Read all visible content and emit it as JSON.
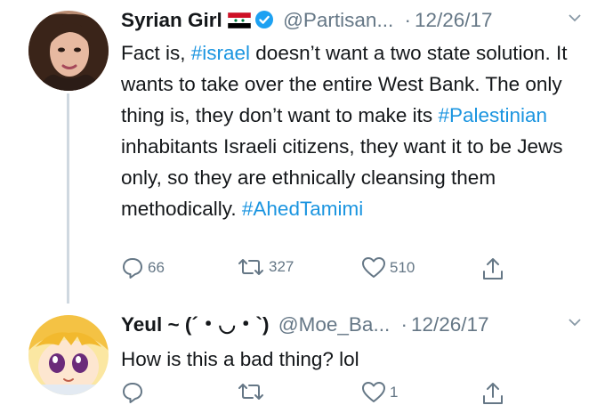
{
  "tweets": [
    {
      "name": "Syrian Girl",
      "handle": "@Partisan...",
      "separator": "·",
      "date": "12/26/17",
      "text_segments": [
        {
          "t": "Fact is, "
        },
        {
          "t": "#israel",
          "tag": true
        },
        {
          "t": " doesn’t want a two state solution. It wants to take over the entire West Bank. The only thing is, they don’t want to make its "
        },
        {
          "t": "#Palestinian",
          "tag": true
        },
        {
          "t": " inhabitants Israeli citizens, they want it to be Jews only, so they are ethnically cleansing them methodically. "
        },
        {
          "t": "#AhedTamimi",
          "tag": true
        }
      ],
      "replies": "66",
      "retweets": "327",
      "likes": "510"
    },
    {
      "name": "Yeul ~ (´・◡・`)",
      "handle": "@Moe_Ba...",
      "separator": "·",
      "date": "12/26/17",
      "text": "How is this a bad thing? lol",
      "replies": "",
      "retweets": "",
      "likes": "1"
    }
  ],
  "colors": {
    "accent": "#1b95e0",
    "verified": "#1da1f2",
    "muted": "#657786",
    "thread_line": "#cfd8e0"
  },
  "icons": [
    "reply-icon",
    "retweet-icon",
    "like-icon",
    "share-icon",
    "verified-badge-icon",
    "syria-flag-icon",
    "chevron-down-icon"
  ]
}
